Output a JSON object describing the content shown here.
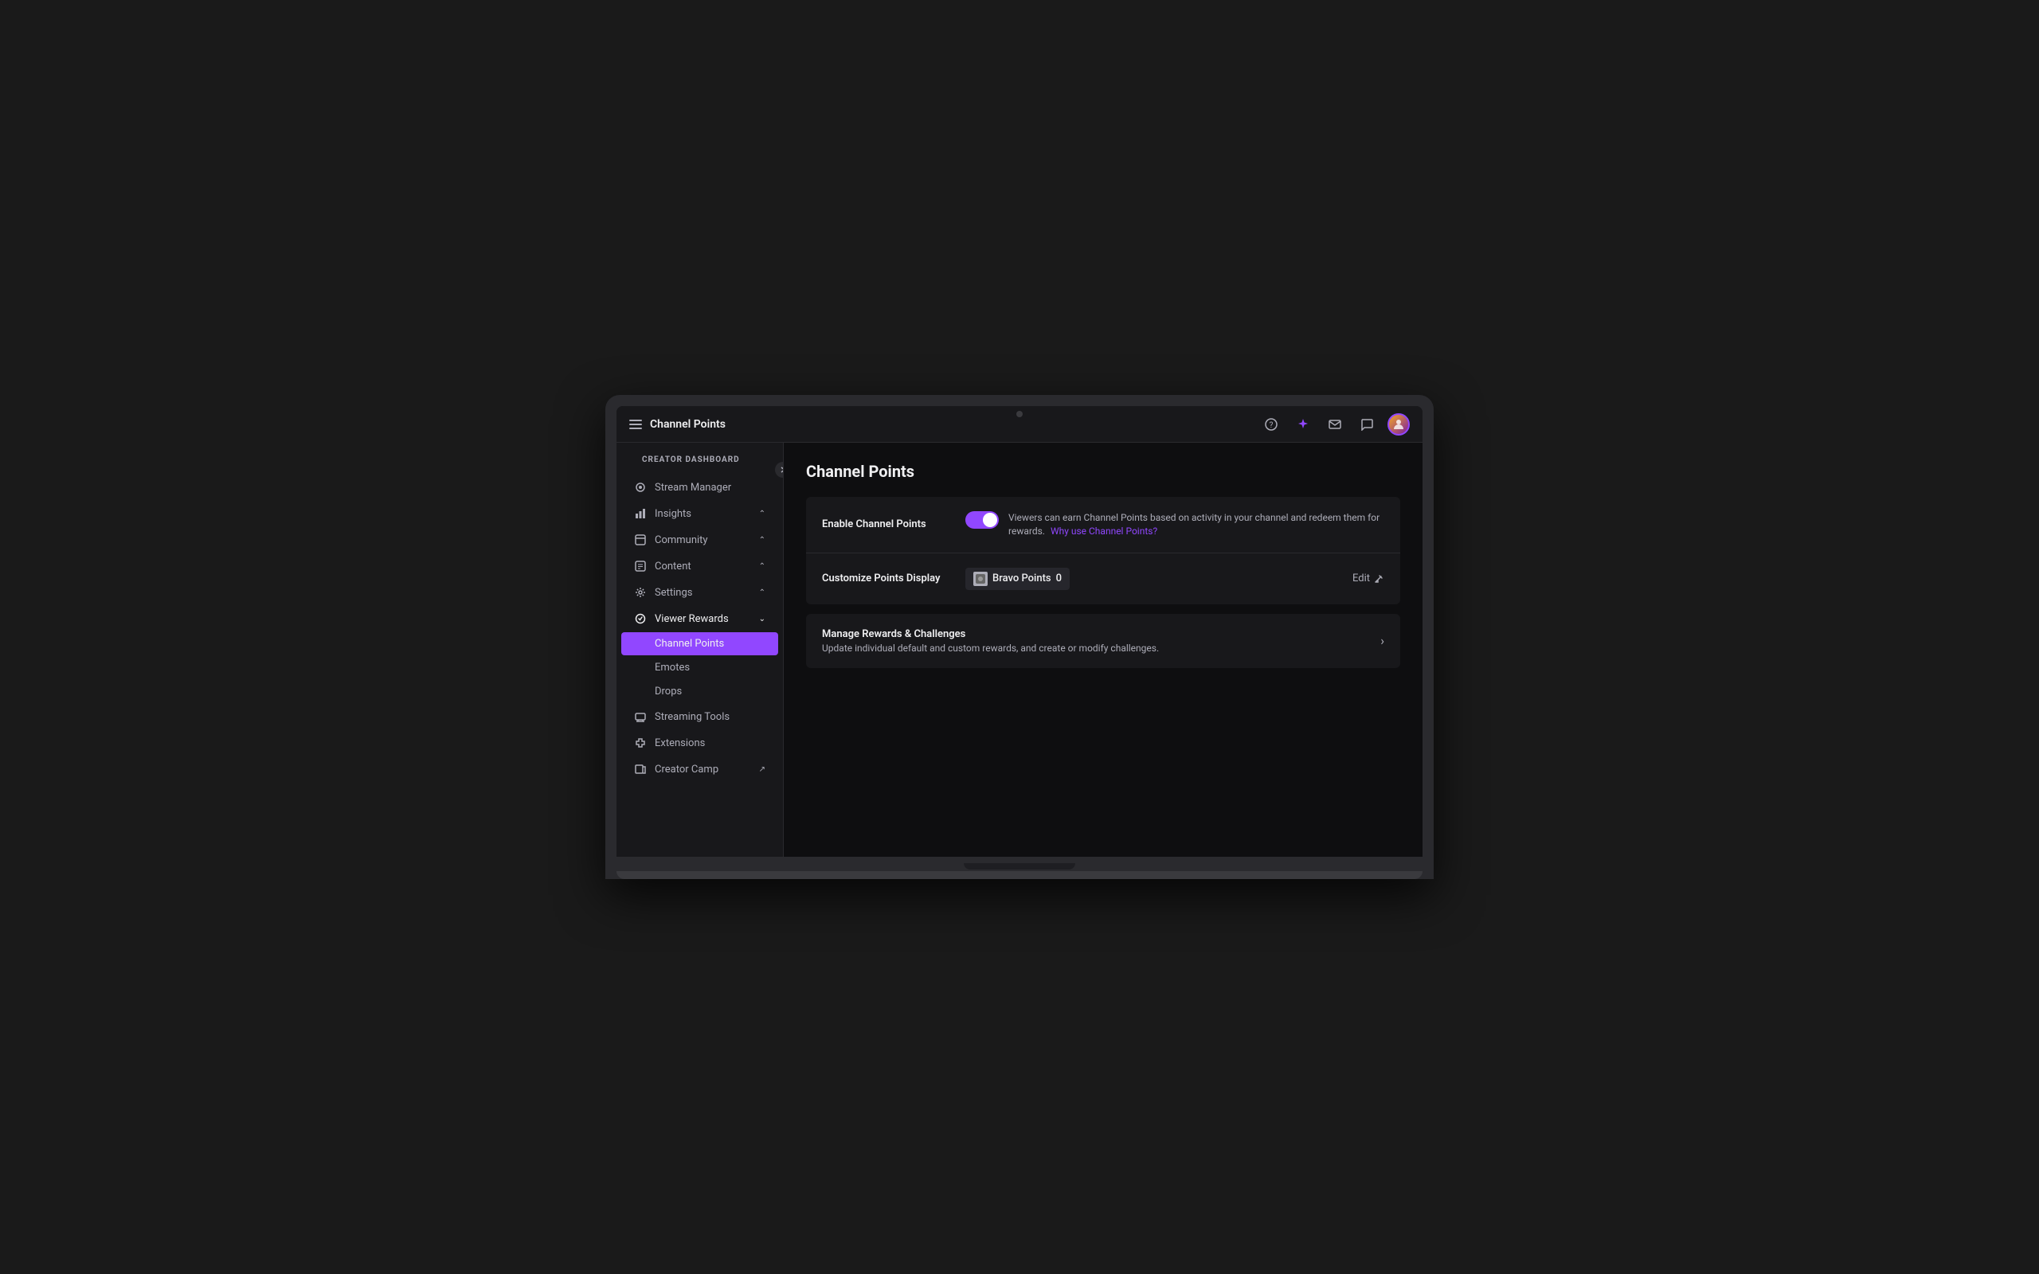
{
  "topbar": {
    "title": "Channel Points",
    "hamburger_label": "menu"
  },
  "sidebar": {
    "section_label": "CREATOR DASHBOARD",
    "items": [
      {
        "id": "stream-manager",
        "label": "Stream Manager",
        "icon": "stream",
        "has_chevron": false,
        "active": false
      },
      {
        "id": "insights",
        "label": "Insights",
        "icon": "insights",
        "has_chevron": true,
        "active": false
      },
      {
        "id": "community",
        "label": "Community",
        "icon": "community",
        "has_chevron": true,
        "active": false
      },
      {
        "id": "content",
        "label": "Content",
        "icon": "content",
        "has_chevron": true,
        "active": false
      },
      {
        "id": "settings",
        "label": "Settings",
        "icon": "settings",
        "has_chevron": true,
        "active": false
      },
      {
        "id": "viewer-rewards",
        "label": "Viewer Rewards",
        "icon": "viewer-rewards",
        "has_chevron": true,
        "active": true,
        "expanded": true
      }
    ],
    "sub_items": [
      {
        "id": "channel-points",
        "label": "Channel Points",
        "active": true
      },
      {
        "id": "emotes",
        "label": "Emotes",
        "active": false
      },
      {
        "id": "drops",
        "label": "Drops",
        "active": false
      }
    ],
    "bottom_items": [
      {
        "id": "streaming-tools",
        "label": "Streaming Tools",
        "icon": "streaming-tools",
        "has_chevron": false,
        "external": false
      },
      {
        "id": "extensions",
        "label": "Extensions",
        "icon": "extensions",
        "has_chevron": false,
        "external": false
      },
      {
        "id": "creator-camp",
        "label": "Creator Camp",
        "icon": "creator-camp",
        "has_chevron": false,
        "external": true
      }
    ]
  },
  "content": {
    "page_title": "Channel Points",
    "enable_section": {
      "label": "Enable Channel Points",
      "toggle_on": true,
      "description": "Viewers can earn Channel Points based on activity in your channel and redeem them for rewards.",
      "link_text": "Why use Channel Points?",
      "link_url": "#"
    },
    "customize_section": {
      "label": "Customize Points Display",
      "points_name": "Bravo Points",
      "points_count": "0",
      "edit_label": "Edit"
    },
    "manage_section": {
      "title": "Manage Rewards & Challenges",
      "description": "Update individual default and custom rewards, and create or modify challenges."
    }
  }
}
